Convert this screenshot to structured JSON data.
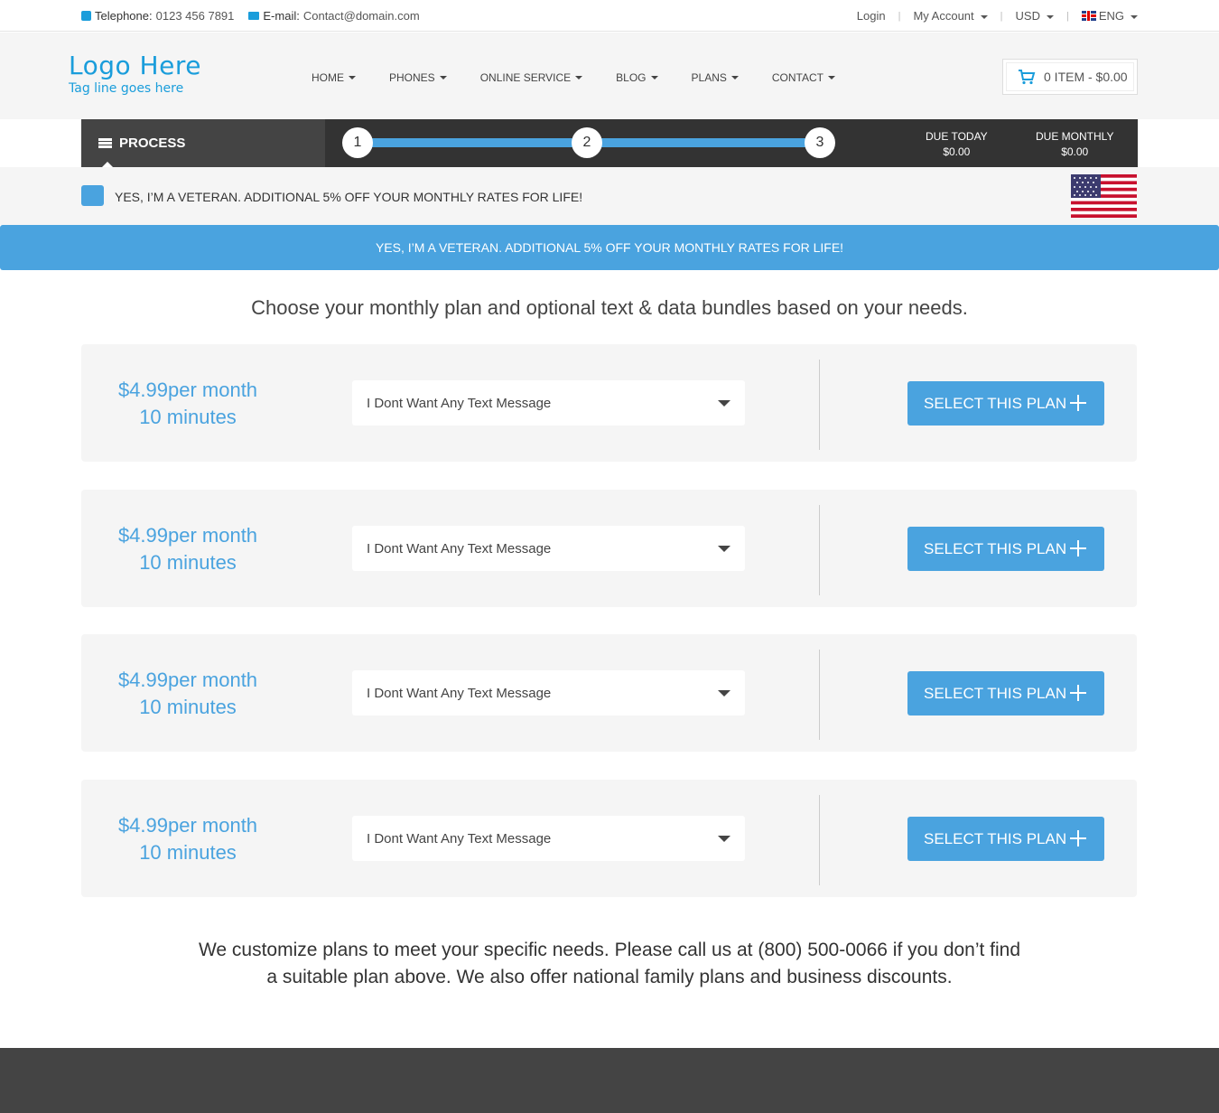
{
  "topbar": {
    "phone_label": "Telephone:",
    "phone_value": "0123 456 7891",
    "email_label": "E-mail:",
    "email_value": "Contact@domain.com",
    "login": "Login",
    "account": "My Account",
    "currency": "USD",
    "language": "ENG"
  },
  "header": {
    "logo": "Logo Here",
    "tagline": "Tag line goes here",
    "nav": [
      "HOME",
      "PHONES",
      "ONLINE SERVICE",
      "BLOG",
      "PLANS",
      "CONTACT"
    ],
    "cart": "0 ITEM - $0.00"
  },
  "process": {
    "label": "PROCESS",
    "steps": [
      "1",
      "2",
      "3"
    ],
    "due_today_label": "DUE TODAY",
    "due_today_value": "$0.00",
    "due_monthly_label": "DUE MONTHLY",
    "due_monthly_value": "$0.00"
  },
  "veteran": {
    "checkbox_label": "YES, I’M A VETERAN. ADDITIONAL 5% OFF YOUR MONTHLY RATES FOR LIFE!",
    "banner": "YES, I’M A VETERAN. ADDITIONAL 5% OFF YOUR MONTHLY RATES FOR LIFE!"
  },
  "headline": "Choose your monthly plan and optional text & data bundles based on your needs.",
  "plans": [
    {
      "price": "$4.99per month",
      "minutes": "10 minutes",
      "select_value": "I Dont Want Any Text Message",
      "button": "SELECT THIS PLAN"
    },
    {
      "price": "$4.99per month",
      "minutes": "10 minutes",
      "select_value": "I Dont Want Any Text Message",
      "button": "SELECT THIS PLAN"
    },
    {
      "price": "$4.99per month",
      "minutes": "10 minutes",
      "select_value": "I Dont Want Any Text Message",
      "button": "SELECT THIS PLAN"
    },
    {
      "price": "$4.99per month",
      "minutes": "10 minutes",
      "select_value": "I Dont Want Any Text Message",
      "button": "SELECT THIS PLAN"
    }
  ],
  "footer_text": {
    "line1": "We customize plans to meet your specific needs. Please call us at (800) 500-0066 if you don’t find",
    "line2": "a suitable plan above. We also offer national family plans and business discounts."
  },
  "colors": {
    "accent": "#4aa3df",
    "logo": "#1a9ddb",
    "dark_bar": "#333333",
    "footer": "#444444"
  }
}
